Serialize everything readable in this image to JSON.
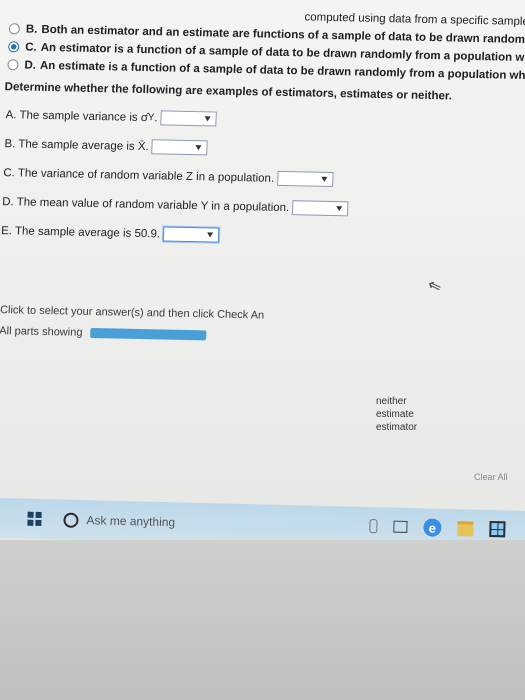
{
  "header": {
    "fragment": "computed using data from a specific sample."
  },
  "options": [
    {
      "letter": "B.",
      "text": "Both an estimator and an estimate are functions of a sample of data to be drawn randomly from a population.",
      "selected": false
    },
    {
      "letter": "C.",
      "text": "An estimator is a function of a sample of data to be drawn randomly from a population whereas an estimate is th",
      "selected": true
    },
    {
      "letter": "D.",
      "text": "An estimate is a function of a sample of data to be drawn randomly from a population whereas an estimator is th",
      "selected": false
    }
  ],
  "instruction": "Determine whether the following are examples of estimators, estimates or neither.",
  "questions": [
    {
      "label": "A. The sample variance is σ̂",
      "sub": "Y",
      "suffix": "."
    },
    {
      "label": "B. The sample average is X̄.",
      "sub": "",
      "suffix": ""
    },
    {
      "label": "C. The variance of random variable Z in a population.",
      "sub": "",
      "suffix": ""
    },
    {
      "label": "D. The mean value of random variable Y in a population.",
      "sub": "",
      "suffix": ""
    },
    {
      "label": "E. The sample average is 50.9.",
      "sub": "",
      "suffix": ""
    }
  ],
  "dropdown_options": [
    "neither",
    "estimate",
    "estimator"
  ],
  "hint": "Click to select your answer(s) and then click Check An",
  "parts": "All parts showing",
  "clear_all": "Clear All",
  "taskbar": {
    "search_placeholder": "Ask me anything"
  },
  "colors": {
    "accent": "#4a9fd8",
    "check": "#3aa847",
    "taskbar": "#c6dcea"
  }
}
